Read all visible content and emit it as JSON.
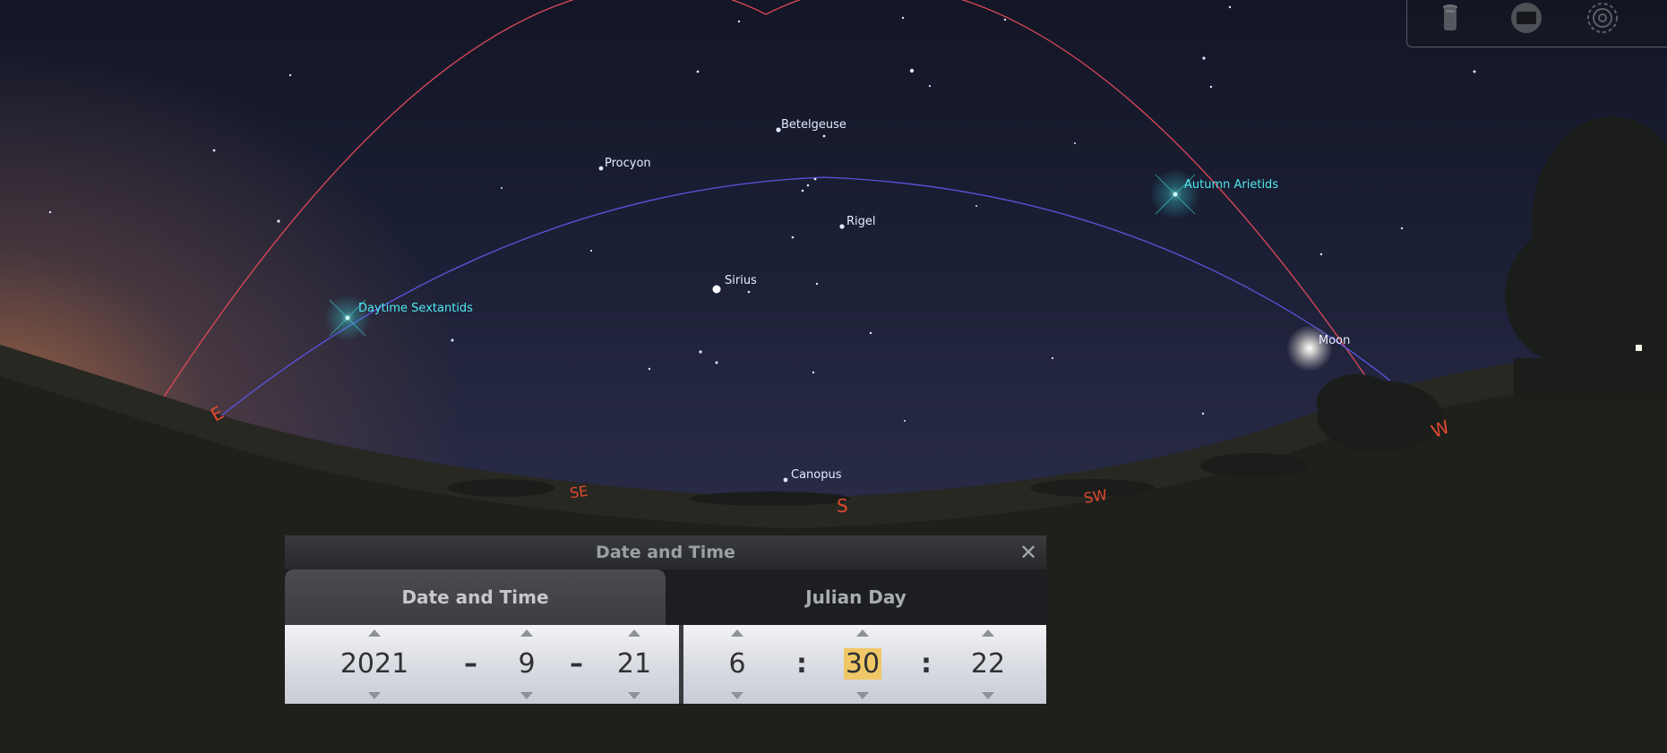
{
  "sky": {
    "stars": {
      "betelgeuse": "Betelgeuse",
      "procyon": "Procyon",
      "rigel": "Rigel",
      "sirius": "Sirius",
      "canopus": "Canopus",
      "moon": "Moon"
    },
    "meteor_showers": {
      "autumn_arietids": "Autumn Arietids",
      "daytime_sextantids": "Daytime Sextantids"
    },
    "cardinal_points": {
      "east": "E",
      "southeast": "SE",
      "south": "S",
      "southwest": "SW",
      "west": "W"
    }
  },
  "toolbar": {
    "icons": [
      "eyepiece-icon",
      "screen-icon",
      "target-icon"
    ]
  },
  "dialog": {
    "title": "Date and Time",
    "tabs": {
      "date_time": "Date and Time",
      "julian_day": "Julian Day"
    },
    "date": {
      "year": "2021",
      "month": "9",
      "day": "21",
      "sep": "–"
    },
    "time": {
      "hour": "6",
      "minute": "30",
      "second": "22",
      "sep": ":"
    },
    "selected_field": "minute"
  },
  "colors": {
    "meteor_label": "#4fe9f0",
    "cardinal": "#e04a30",
    "meridian_line": "#e0485a",
    "ecliptic_line": "#5a55e0",
    "selected_highlight": "#f0c766"
  }
}
